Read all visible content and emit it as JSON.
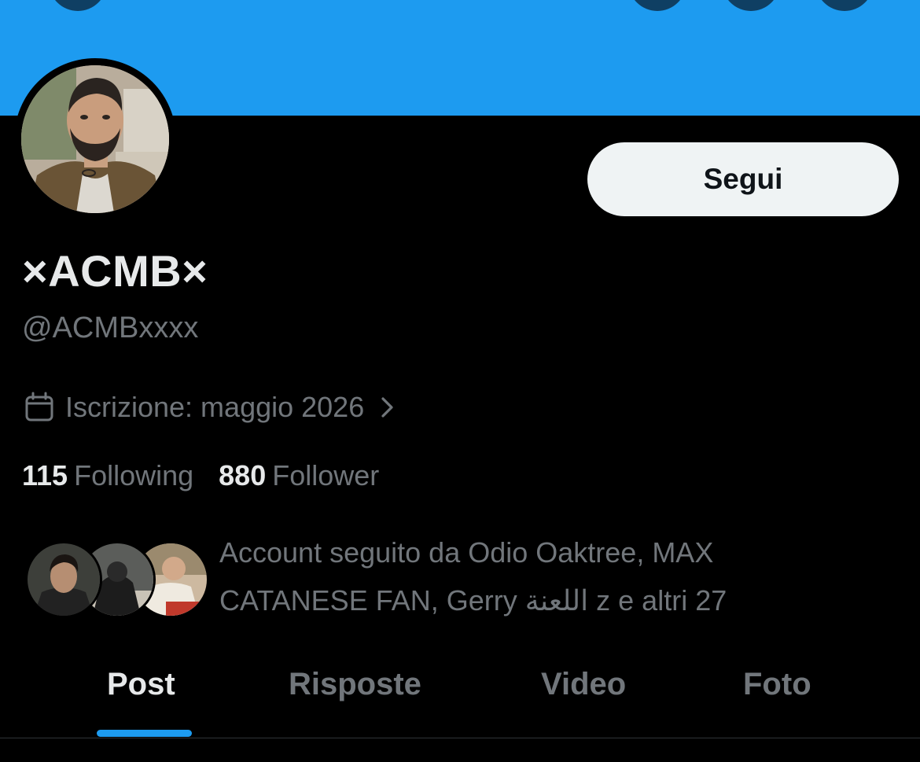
{
  "profile": {
    "display_name": "×ACMB×",
    "handle": "@ACMBxxxx",
    "joined": "Iscrizione: maggio 2026",
    "follow_label": "Segui"
  },
  "stats": {
    "following_count": "115",
    "following_label": "Following",
    "followers_count": "880",
    "followers_label": "Follower"
  },
  "followed_by": {
    "text": "Account seguito da Odio Oaktree, MAX CATANESE FAN, Gerry اللعنة z e altri 27"
  },
  "tabs": [
    {
      "label": "Post",
      "active": true
    },
    {
      "label": "Risposte",
      "active": false
    },
    {
      "label": "Video",
      "active": false
    },
    {
      "label": "Foto",
      "active": false
    }
  ],
  "colors": {
    "banner": "#1d9bf0",
    "accent": "#1d9bf0",
    "background": "#000000",
    "primary_text": "#e7e9ea",
    "secondary_text": "#71767b",
    "button_bg": "#eff3f4"
  },
  "icons": {
    "joined": "calendar-icon",
    "joined_more": "chevron-right-icon"
  }
}
